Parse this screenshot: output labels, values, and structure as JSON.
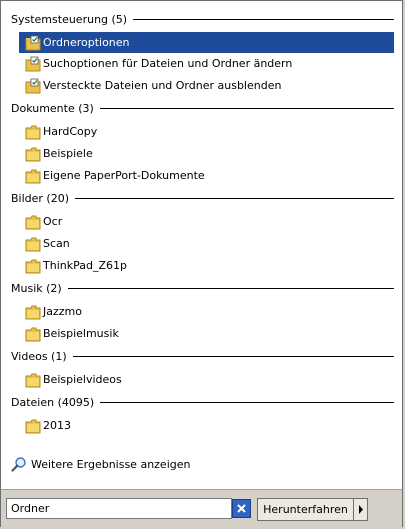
{
  "groups": [
    {
      "title": "Systemsteuerung (5)",
      "items": [
        {
          "label": "Ordneroptionen",
          "icon": "control-panel-folder-icon",
          "selected": true
        },
        {
          "label": "Suchoptionen für Dateien und Ordner ändern",
          "icon": "control-panel-folder-icon"
        },
        {
          "label": "Versteckte Dateien und Ordner ausblenden",
          "icon": "control-panel-folder-icon"
        }
      ]
    },
    {
      "title": "Dokumente (3)",
      "items": [
        {
          "label": "HardCopy",
          "icon": "folder-icon"
        },
        {
          "label": "Beispiele",
          "icon": "folder-icon"
        },
        {
          "label": "Eigene PaperPort-Dokumente",
          "icon": "folder-icon"
        }
      ]
    },
    {
      "title": "Bilder (20)",
      "items": [
        {
          "label": "Ocr",
          "icon": "folder-icon"
        },
        {
          "label": "Scan",
          "icon": "folder-icon"
        },
        {
          "label": "ThinkPad_Z61p",
          "icon": "folder-icon"
        }
      ]
    },
    {
      "title": "Musik (2)",
      "items": [
        {
          "label": "Jazzmo",
          "icon": "folder-icon"
        },
        {
          "label": "Beispielmusik",
          "icon": "folder-icon"
        }
      ]
    },
    {
      "title": "Videos (1)",
      "items": [
        {
          "label": "Beispielvideos",
          "icon": "folder-icon"
        }
      ]
    },
    {
      "title": "Dateien (4095)",
      "items": [
        {
          "label": "2013",
          "icon": "folder-icon"
        }
      ]
    }
  ],
  "more_results_label": "Weitere Ergebnisse anzeigen",
  "search": {
    "value": "Ordner",
    "clear_icon": "clear-x-icon"
  },
  "shutdown_label": "Herunterfahren",
  "colors": {
    "selection": "#1e4c9a",
    "folder": "#e8c24a"
  }
}
